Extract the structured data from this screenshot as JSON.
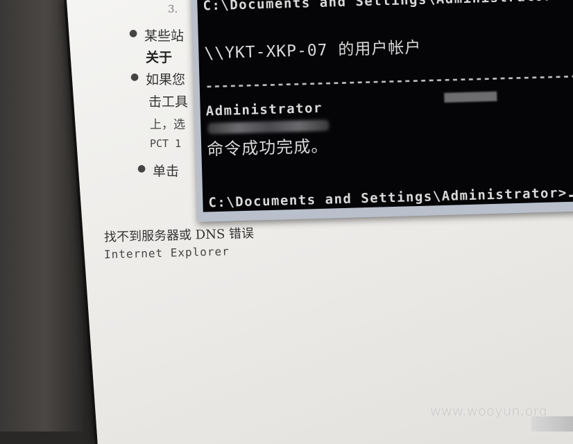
{
  "browser_page": {
    "step_number": "3.",
    "bullets": [
      {
        "line1": "某些站",
        "line2": "关于"
      },
      {
        "line1": "如果您",
        "line2": "击工具",
        "line3": "上，选",
        "line4": "PCT 1"
      },
      {
        "line1": "单击"
      }
    ],
    "error_title": "找不到服务器或 DNS 错误",
    "error_subtitle": "Internet Explorer"
  },
  "cmd_window": {
    "prompt_top": "C:\\Documents and Settings\\Administrator>",
    "header": "\\\\YKT-XKP-07 的用户帐户",
    "separator": "-------------------------------------------------------------------",
    "user": "Administrator",
    "result": "命令成功完成。",
    "prompt_bottom": "C:\\Documents and Settings\\Administrator>"
  },
  "watermark": "www.wooyun.org",
  "colors": {
    "console_bg": "#050507",
    "console_text": "#d9d9d9",
    "window_frame": "#b9c0cc",
    "page_bg": "#f0efec"
  }
}
